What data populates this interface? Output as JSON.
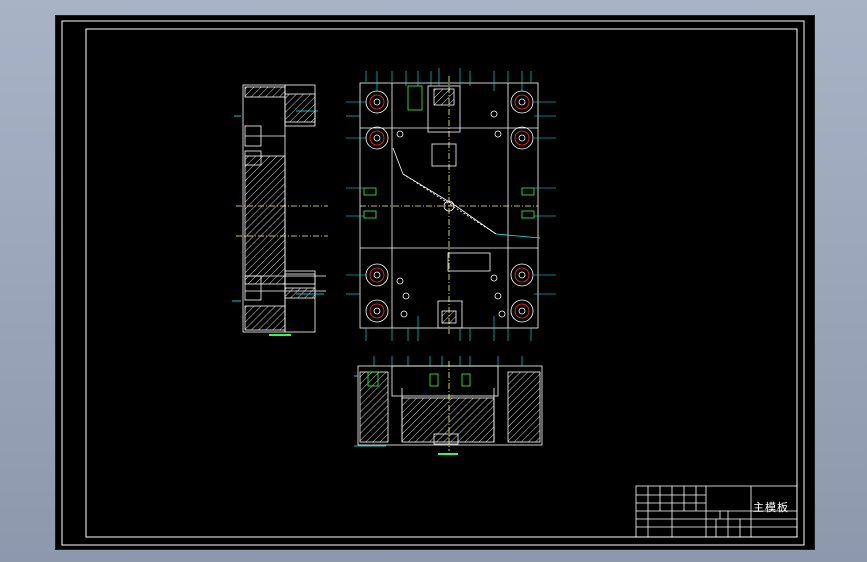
{
  "title_block": {
    "part_name": "主模板"
  },
  "colors": {
    "background_outer": "#9aa4b8",
    "canvas": "#000000",
    "frame": "#ffffff",
    "outline": "#ffffff",
    "hatch": "#ffffff",
    "dimension": "#00ffff",
    "feature_red": "#ff3030",
    "feature_green": "#30ff30",
    "center": "#ffff66"
  },
  "icons": [
    "drawing-canvas"
  ]
}
